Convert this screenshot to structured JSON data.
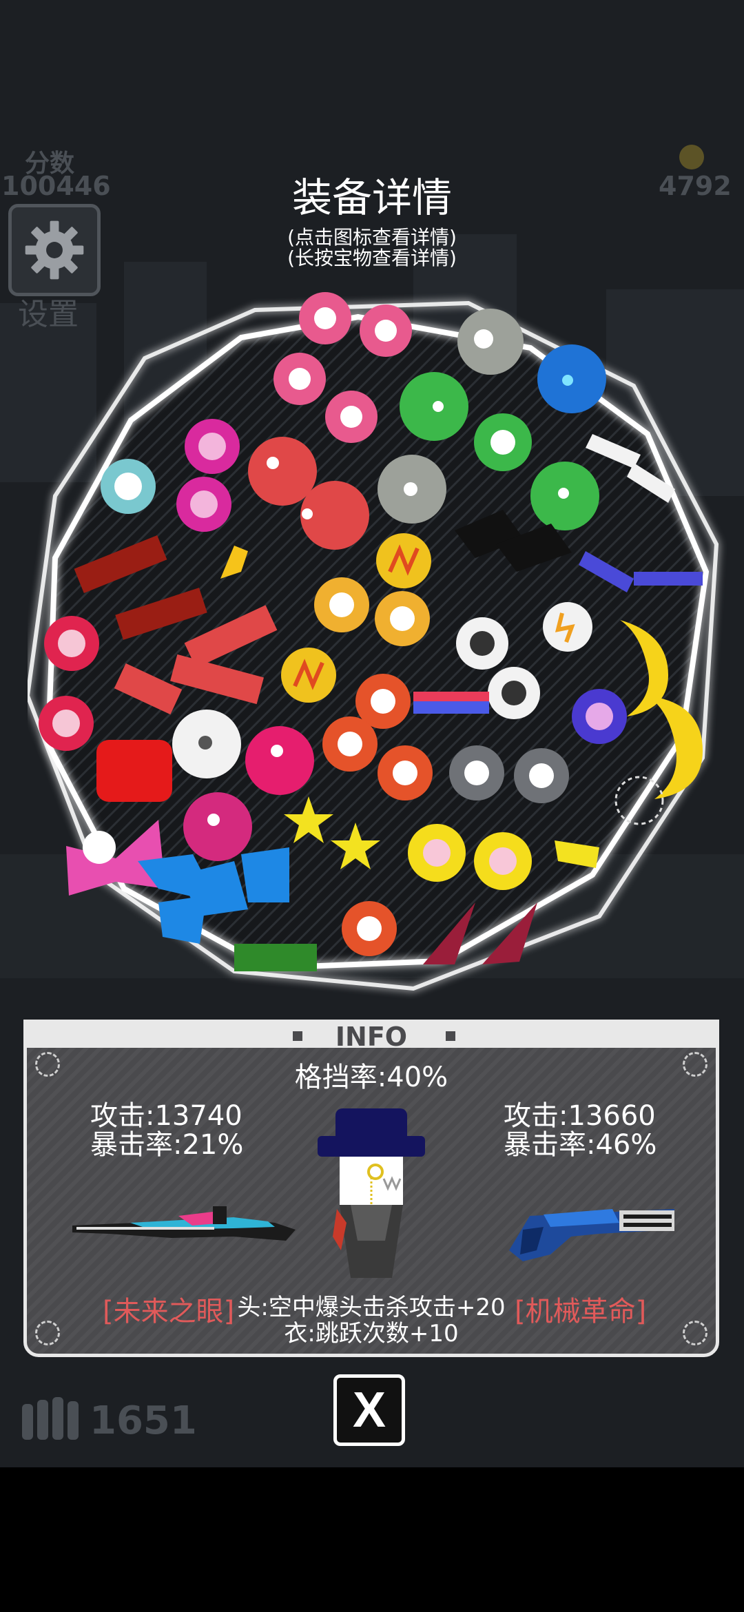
{
  "header": {
    "title": "装备详情",
    "hint_tap": "(点击图标查看详情)",
    "hint_hold": "(长按宝物查看详情)"
  },
  "hud": {
    "score_label": "分数",
    "score_value": "100446",
    "coins": "4792",
    "settings_label": "设置",
    "ammo": "1651"
  },
  "info": {
    "title": "INFO",
    "block_rate": "格挡率:40%",
    "left_weapon": {
      "attack": "攻击:13740",
      "crit": "暴击率:21%",
      "name": "[未来之眼]"
    },
    "right_weapon": {
      "attack": "攻击:13660",
      "crit": "暴击率:46%",
      "name": "[机械革命]"
    },
    "effects": [
      "头:空中爆头击杀攻击+20",
      "衣:跳跃次数+10"
    ]
  },
  "close_label": "X",
  "colors": {
    "background": "#1c1f23",
    "panel": "#4a4a4d",
    "panel_border": "#e8e8e8",
    "weapon_name": "#e05a5a",
    "hud_dim": "#4a4f55"
  }
}
